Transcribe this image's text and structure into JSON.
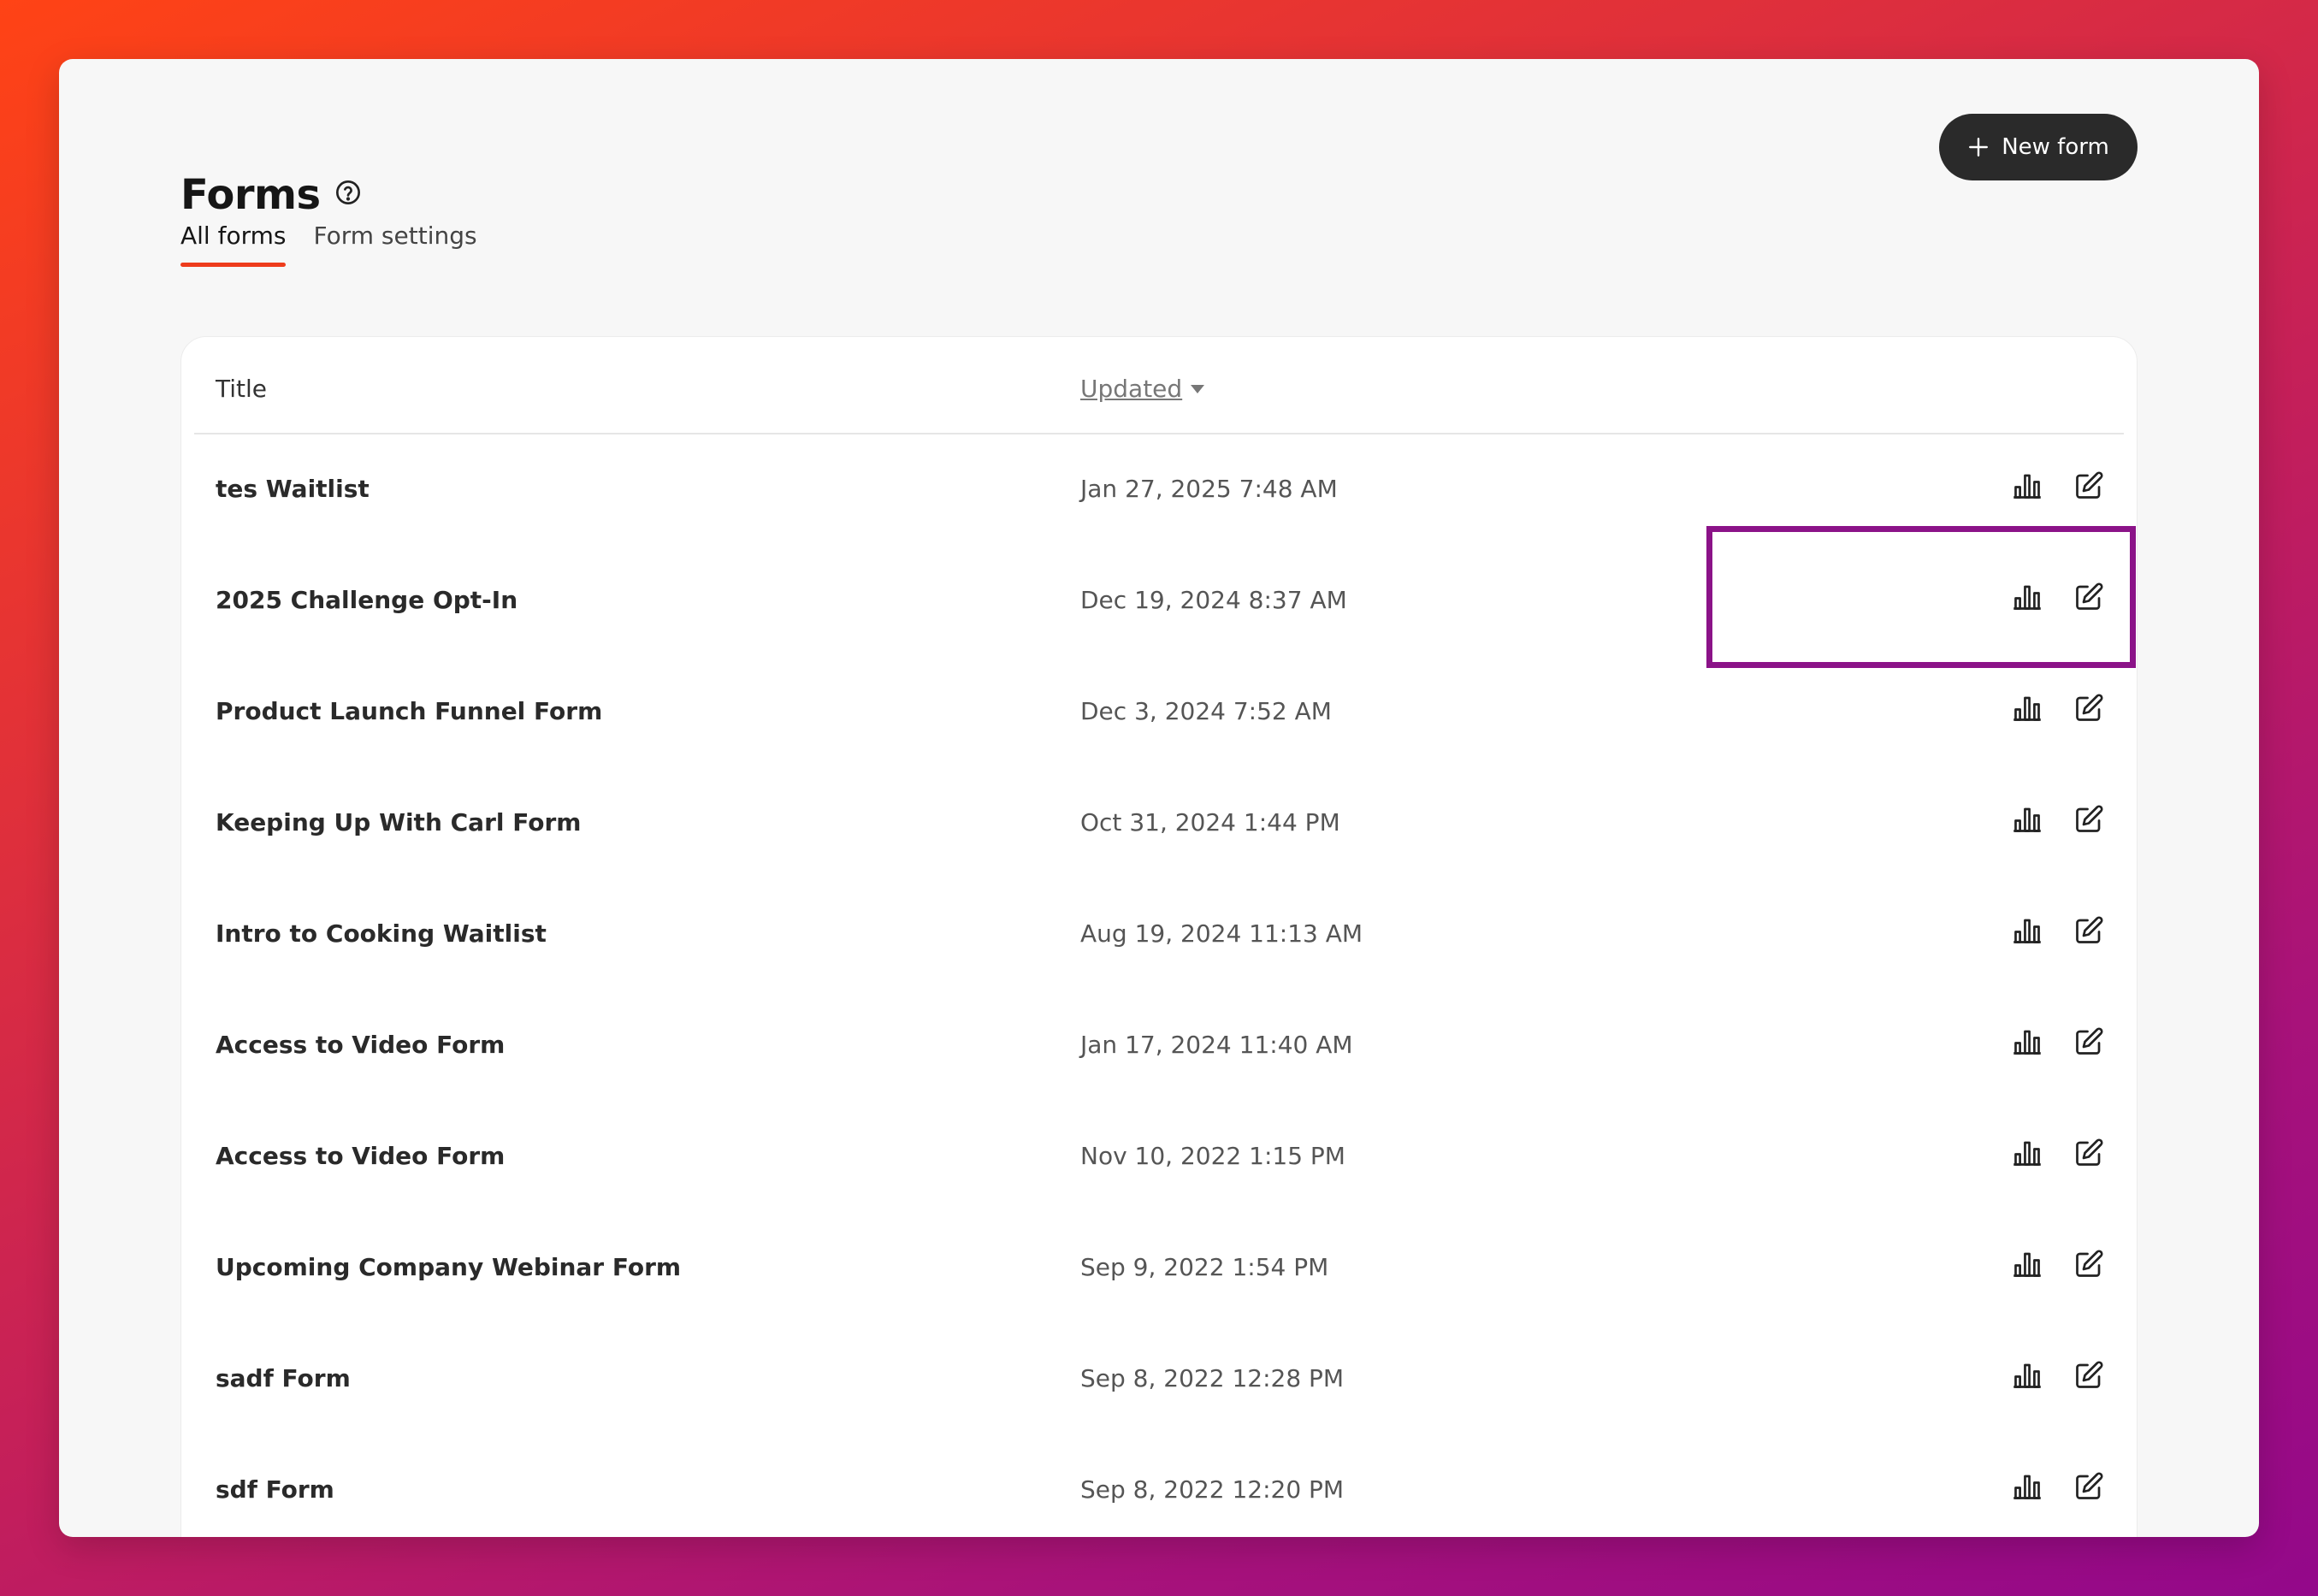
{
  "header": {
    "title": "Forms",
    "help_icon": "help-circle-icon",
    "new_form_label": "New form",
    "new_form_icon": "plus-icon"
  },
  "tabs": [
    {
      "label": "All forms",
      "active": true
    },
    {
      "label": "Form settings",
      "active": false
    }
  ],
  "table": {
    "columns": {
      "title": "Title",
      "updated": "Updated",
      "sort_icon": "caret-down-icon"
    },
    "rows": [
      {
        "title": "tes Waitlist",
        "updated": "Jan 27, 2025 7:48 AM"
      },
      {
        "title": "2025 Challenge Opt-In",
        "updated": "Dec 19, 2024 8:37 AM"
      },
      {
        "title": "Product Launch Funnel Form",
        "updated": "Dec 3, 2024 7:52 AM"
      },
      {
        "title": "Keeping Up With Carl Form",
        "updated": "Oct 31, 2024 1:44 PM"
      },
      {
        "title": "Intro to Cooking Waitlist",
        "updated": "Aug 19, 2024 11:13 AM"
      },
      {
        "title": "Access to Video Form",
        "updated": "Jan 17, 2024 11:40 AM"
      },
      {
        "title": "Access to Video Form",
        "updated": "Nov 10, 2022 1:15 PM"
      },
      {
        "title": "Upcoming Company Webinar Form",
        "updated": "Sep 9, 2022 1:54 PM"
      },
      {
        "title": "sadf Form",
        "updated": "Sep 8, 2022 12:28 PM"
      },
      {
        "title": "sdf Form",
        "updated": "Sep 8, 2022 12:20 PM"
      }
    ],
    "row_action_icons": [
      "bar-chart-icon",
      "edit-icon"
    ]
  },
  "colors": {
    "accent": "#ee3c1c",
    "button_bg": "#2a2a2a",
    "highlight": "#8b1388"
  }
}
